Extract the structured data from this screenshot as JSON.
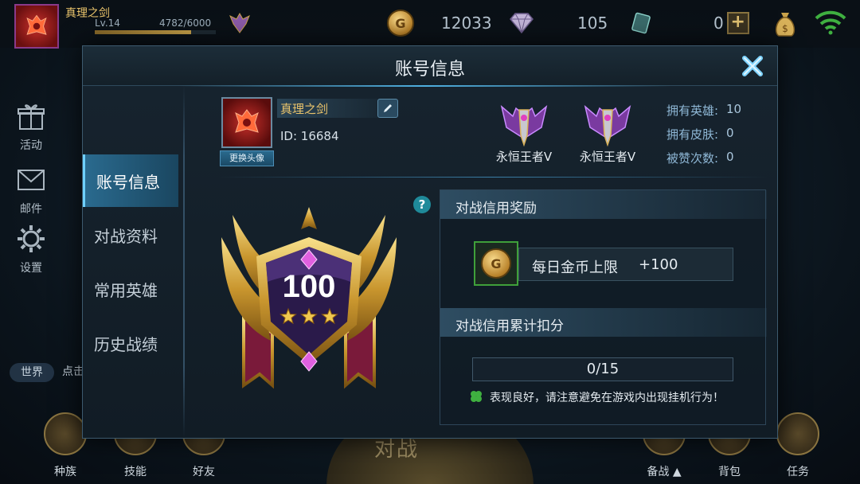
{
  "player": {
    "name": "真理之剑",
    "level": "Lv.14",
    "exp": "4782/6000",
    "exp_progress": 0.797
  },
  "resources": {
    "gold": "12033",
    "diamonds": "105",
    "tickets": "0"
  },
  "side_menu": [
    {
      "label": "活动",
      "icon": "gift-icon"
    },
    {
      "label": "邮件",
      "icon": "mail-icon"
    },
    {
      "label": "设置",
      "icon": "gear-icon"
    }
  ],
  "chat": {
    "channel": "世界",
    "text": "点击"
  },
  "bottom_nav": [
    {
      "label": "种族"
    },
    {
      "label": "技能"
    },
    {
      "label": "好友"
    },
    {
      "label": "备战 ▲"
    },
    {
      "label": "背包"
    },
    {
      "label": "任务"
    }
  ],
  "mode_banner": "对战",
  "dialog": {
    "title": "账号信息",
    "tabs": [
      {
        "label": "账号信息",
        "active": true
      },
      {
        "label": "对战资料",
        "active": false
      },
      {
        "label": "常用英雄",
        "active": false
      },
      {
        "label": "历史战绩",
        "active": false
      }
    ],
    "profile": {
      "name": "真理之剑",
      "id": "ID: 16684",
      "change_avatar": "更换头像"
    },
    "ranks": [
      {
        "name": "永恒王者Ⅴ"
      },
      {
        "name": "永恒王者Ⅴ"
      }
    ],
    "stats": [
      {
        "label": "拥有英雄:",
        "value": "10"
      },
      {
        "label": "拥有皮肤:",
        "value": "0"
      },
      {
        "label": "被赞次数:",
        "value": "0"
      }
    ],
    "credit": {
      "score": "100",
      "stars": 3
    },
    "help_symbol": "?",
    "reward_section": {
      "title": "对战信用奖励",
      "reward_label": "每日金币上限",
      "reward_value": "+100"
    },
    "deduct_section": {
      "title": "对战信用累计扣分",
      "value": "0/15",
      "tip": "表现良好，请注意避免在游戏内出现挂机行为！"
    }
  },
  "colors": {
    "accent_gold": "#e9c36b",
    "tab_active": "#2a6a8e",
    "close_blue": "#7fd4ff",
    "reward_border": "#3fa03a"
  }
}
